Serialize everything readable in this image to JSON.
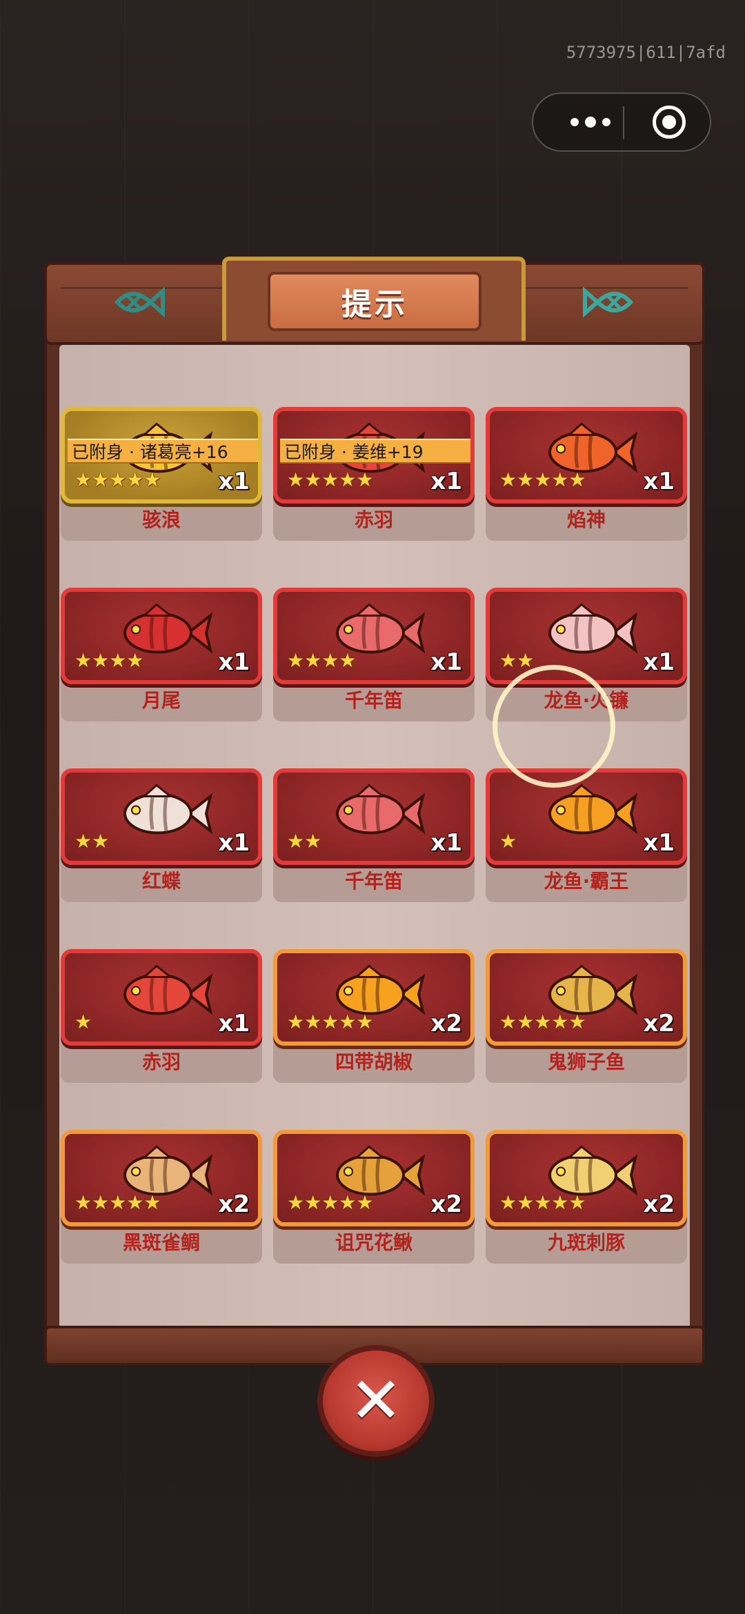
{
  "build_id": "5773975|611|7afd",
  "title": "提示",
  "colors": {
    "frame": "#5a2d22",
    "tile_red": "#e33a3a",
    "tile_gold": "#e0b83a",
    "tile_orange": "#f09a3a",
    "name": "#b3221c",
    "star": "#ffd640"
  },
  "capsule": {
    "more_icon": "more-dots-icon",
    "close_icon": "target-circle-icon"
  },
  "items": [
    {
      "name": "骇浪",
      "stars": "★★★★★",
      "count": "x1",
      "attached": "已附身 · 诸葛亮+16",
      "tile": "gold",
      "fish": "#f6c33a"
    },
    {
      "name": "赤羽",
      "stars": "★★★★★",
      "count": "x1",
      "attached": "已附身 · 姜维+19",
      "tile": "red",
      "fish": "#e5463a"
    },
    {
      "name": "焰神",
      "stars": "★★★★★",
      "count": "x1",
      "attached": "",
      "tile": "red",
      "fish": "#f0632a"
    },
    {
      "name": "月尾",
      "stars": "★★★★",
      "count": "x1",
      "attached": "",
      "tile": "red",
      "fish": "#d63030"
    },
    {
      "name": "千年笛",
      "stars": "★★★★",
      "count": "x1",
      "attached": "",
      "tile": "red",
      "fish": "#e86a6a"
    },
    {
      "name": "龙鱼·火镰",
      "stars": "★★",
      "count": "x1",
      "attached": "",
      "tile": "red",
      "fish": "#f3c2c2"
    },
    {
      "name": "红蝶",
      "stars": "★★",
      "count": "x1",
      "attached": "",
      "tile": "red",
      "fish": "#efe0d8"
    },
    {
      "name": "千年笛",
      "stars": "★★",
      "count": "x1",
      "attached": "",
      "tile": "red",
      "fish": "#e86a6a"
    },
    {
      "name": "龙鱼·霸王",
      "stars": "★",
      "count": "x1",
      "attached": "",
      "tile": "red",
      "fish": "#f5a020"
    },
    {
      "name": "赤羽",
      "stars": "★",
      "count": "x1",
      "attached": "",
      "tile": "red",
      "fish": "#e5463a"
    },
    {
      "name": "四带胡椒",
      "stars": "★★★★★",
      "count": "x2",
      "attached": "",
      "tile": "orange",
      "fish": "#f6a21e"
    },
    {
      "name": "鬼狮子鱼",
      "stars": "★★★★★",
      "count": "x2",
      "attached": "",
      "tile": "orange",
      "fish": "#e6b54a"
    },
    {
      "name": "黑斑雀鲷",
      "stars": "★★★★★",
      "count": "x2",
      "attached": "",
      "tile": "orange",
      "fish": "#e8b47a"
    },
    {
      "name": "诅咒花鳅",
      "stars": "★★★★★",
      "count": "x2",
      "attached": "",
      "tile": "orange",
      "fish": "#e6a23a"
    },
    {
      "name": "九斑刺豚",
      "stars": "★★★★★",
      "count": "x2",
      "attached": "",
      "tile": "orange",
      "fish": "#f0d070"
    }
  ]
}
